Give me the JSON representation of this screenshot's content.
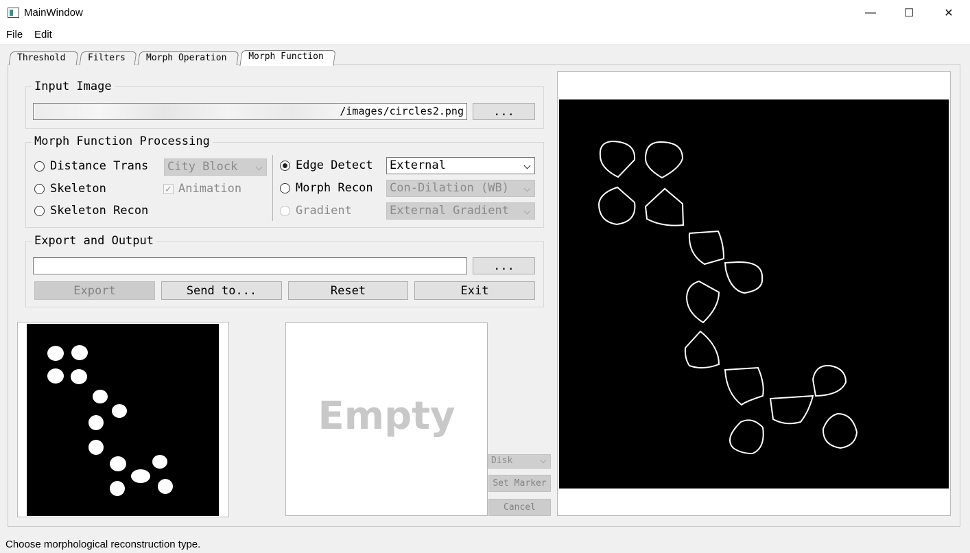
{
  "window": {
    "title": "MainWindow",
    "controls": {
      "minimize": "—",
      "maximize": "☐",
      "close": "✕"
    }
  },
  "menu": {
    "file": "File",
    "edit": "Edit"
  },
  "tabs": [
    "Threshold",
    "Filters",
    "Morph Operation",
    "Morph Function"
  ],
  "active_tab": "Morph Function",
  "input_image": {
    "title": "Input Image",
    "path": "/images/circles2.png",
    "browse_label": "..."
  },
  "processing": {
    "title": "Morph Function Processing",
    "distance_trans": {
      "label": "Distance Trans",
      "combo": "City Block"
    },
    "skeleton": {
      "label": "Skeleton",
      "animation_label": "Animation",
      "animation_checked": true
    },
    "skeleton_recon": {
      "label": "Skeleton Recon"
    },
    "edge_detect": {
      "label": "Edge Detect",
      "combo": "External",
      "selected": true
    },
    "morph_recon": {
      "label": "Morph Recon",
      "combo": "Con-Dilation (WB)"
    },
    "gradient": {
      "label": "Gradient",
      "combo": "External Gradient"
    }
  },
  "export": {
    "title": "Export and Output",
    "path": "",
    "browse_label": "...",
    "buttons": {
      "export": "Export",
      "send_to": "Send to...",
      "reset": "Reset",
      "exit": "Exit"
    }
  },
  "marker": {
    "placeholder": "Empty",
    "shape_combo": "Disk",
    "set_marker": "Set Marker",
    "cancel": "Cancel"
  },
  "status": "Choose morphological reconstruction type.",
  "colors": {
    "image_bg": "#000000",
    "blob": "#ffffff",
    "disabled_button": "#cccccc"
  }
}
